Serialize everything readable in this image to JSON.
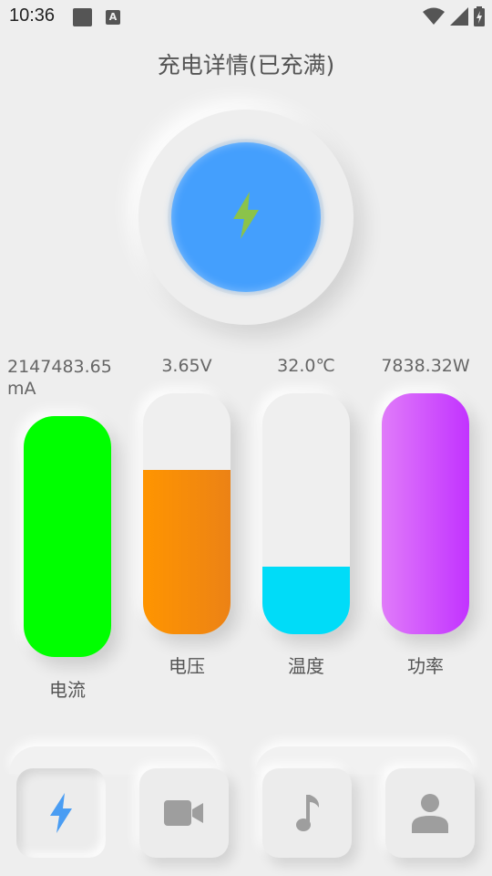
{
  "status_bar": {
    "time": "10:36",
    "notification_a": "A"
  },
  "header": {
    "title": "充电详情(已充满)"
  },
  "charge_button": {
    "icon": "lightning-icon",
    "colors": {
      "circle": "#449ffd",
      "bolt": "#8bc34a"
    }
  },
  "gauges": [
    {
      "id": "current",
      "value": "2147483.65",
      "unit": "mA",
      "name": "电流",
      "level": 1.0,
      "color": "#00ff00"
    },
    {
      "id": "voltage",
      "value": "3.65V",
      "name": "电压",
      "level": 0.68,
      "color": "#f58d05"
    },
    {
      "id": "temperature",
      "value": "32.0℃",
      "name": "温度",
      "level": 0.28,
      "color": "#00dcf8"
    },
    {
      "id": "power",
      "value": "7838.32W",
      "name": "功率",
      "level": 1.0,
      "color": "#c737ff"
    }
  ],
  "bottom_nav": [
    {
      "id": "charge",
      "icon": "lightning-icon",
      "active": true,
      "color": "#4a9df3"
    },
    {
      "id": "video",
      "icon": "video-camera-icon",
      "active": false
    },
    {
      "id": "music",
      "icon": "music-note-icon",
      "active": false
    },
    {
      "id": "profile",
      "icon": "person-icon",
      "active": false
    }
  ]
}
